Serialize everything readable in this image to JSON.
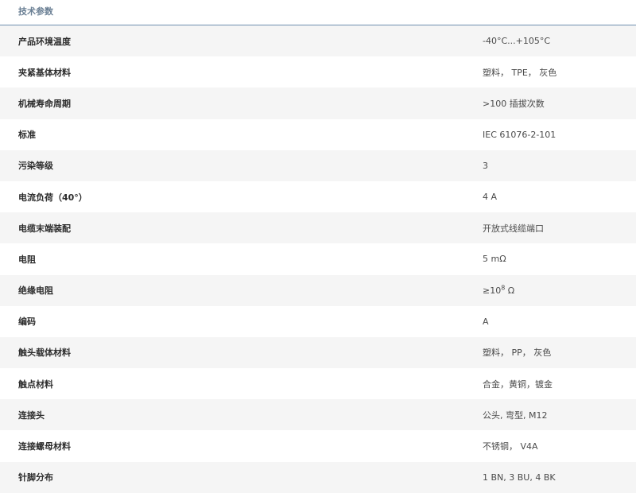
{
  "header": {
    "title": "技术参数"
  },
  "rows": [
    {
      "label": "产品环境温度",
      "value": "-40°C...+105°C"
    },
    {
      "label": "夹紧基体材料",
      "value": "塑料， TPE， 灰色"
    },
    {
      "label": "机械寿命周期",
      "value": ">100 插拔次数"
    },
    {
      "label": "标准",
      "value": "IEC 61076-2-101"
    },
    {
      "label": "污染等级",
      "value": "3"
    },
    {
      "label": "电流负荷（40°）",
      "value": "4 A"
    },
    {
      "label": "电缆末端装配",
      "value": "开放式线缆端口"
    },
    {
      "label": "电阻",
      "value": "5 mΩ"
    },
    {
      "label": "绝缘电阻",
      "value_prefix": "≥10",
      "value_sup": "8",
      "value_suffix": " Ω"
    },
    {
      "label": "编码",
      "value": "A"
    },
    {
      "label": "触头载体材料",
      "value": "塑料， PP， 灰色"
    },
    {
      "label": "触点材料",
      "value": "合金，黄铜，镀金"
    },
    {
      "label": "连接头",
      "value": "公头, 弯型, M12"
    },
    {
      "label": "连接螺母材料",
      "value": "不锈钢， V4A"
    },
    {
      "label": "针脚分布",
      "value": "1 BN, 3 BU, 4 BK"
    }
  ]
}
